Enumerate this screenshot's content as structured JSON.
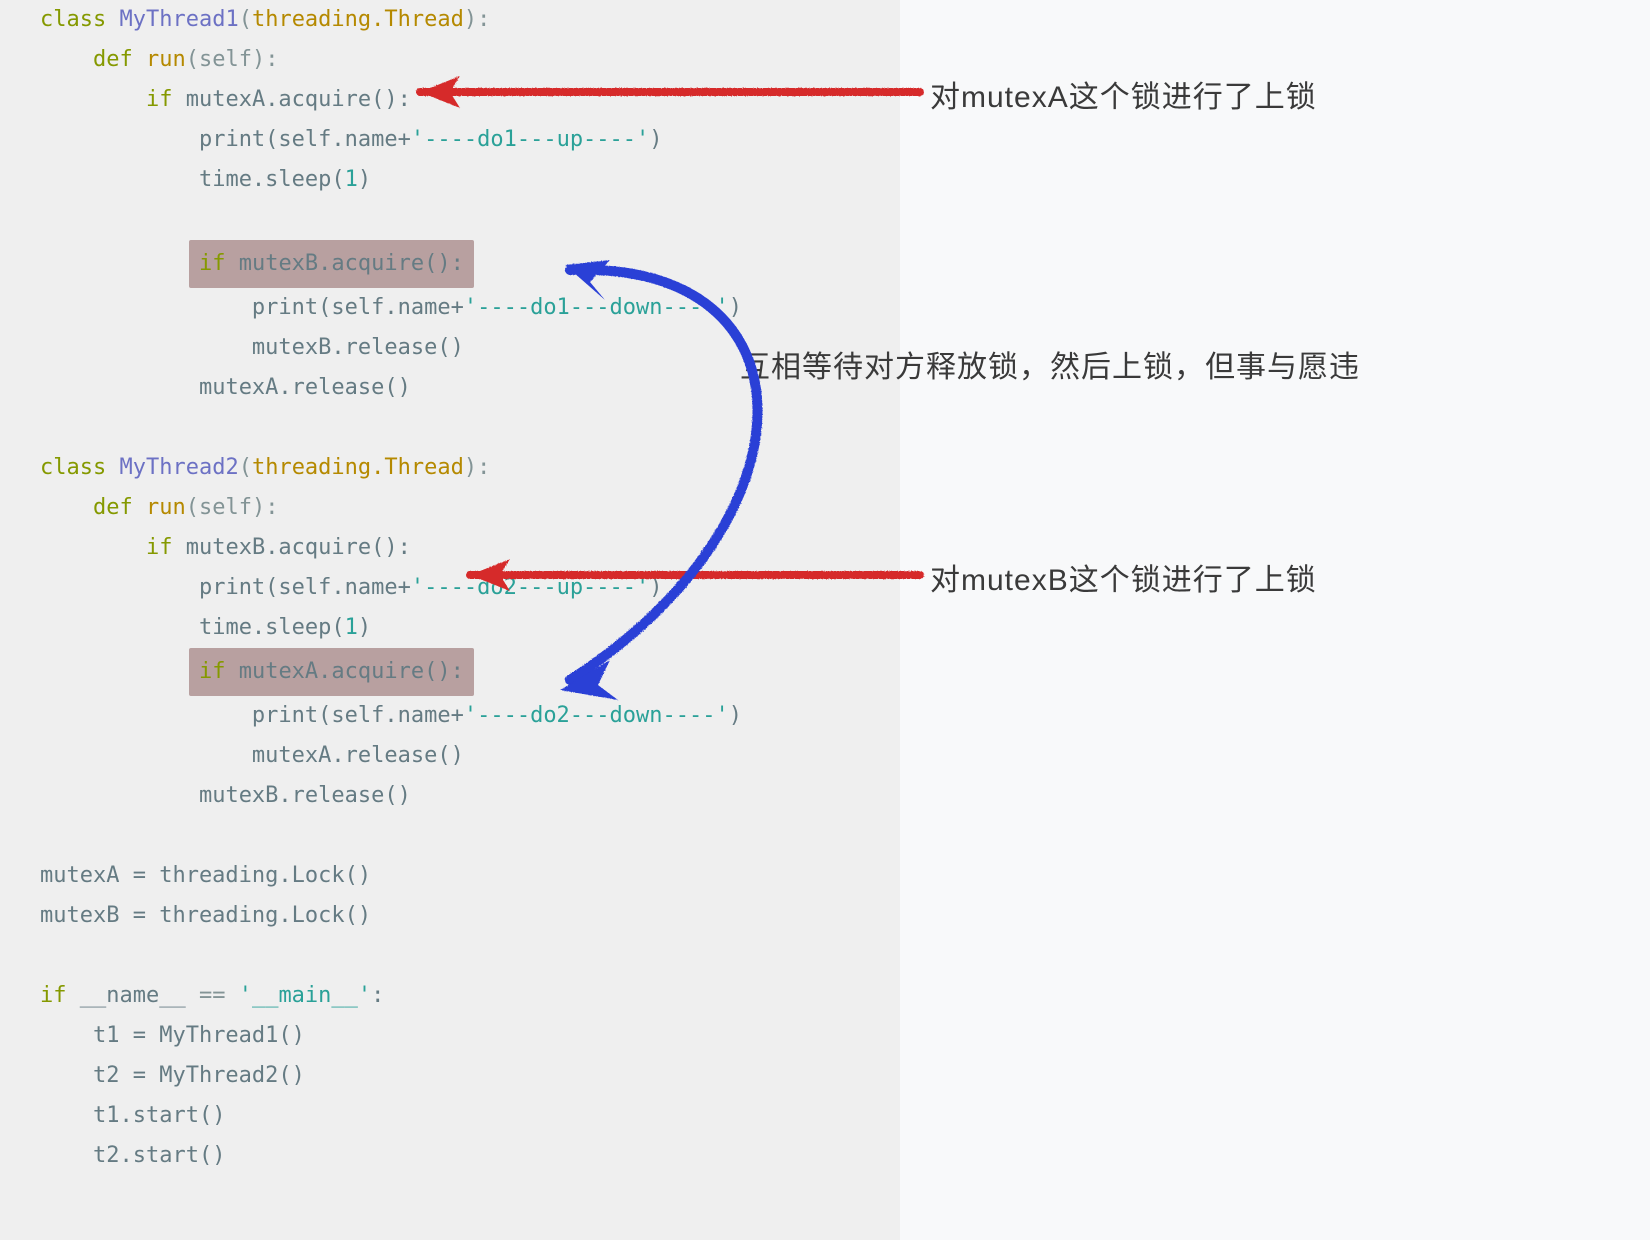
{
  "code": {
    "line1_class": "class ",
    "line1_name": "MyThread1",
    "line1_paren_open": "(",
    "line1_arg": "threading.Thread",
    "line1_paren_close": "):",
    "line2_def": "def ",
    "line2_fn": "run",
    "line2_args": "(self):",
    "line3_if": "if ",
    "line3_cond": "mutexA.acquire():",
    "line4": "print(self.name+",
    "line4_str": "'----do1---up----'",
    "line4_end": ")",
    "line5": "time.sleep(",
    "line5_num": "1",
    "line5_end": ")",
    "line7_if": "if ",
    "line7_cond": "mutexB.acquire():",
    "line8": "print(self.name+",
    "line8_str": "'----do1---down----'",
    "line8_end": ")",
    "line9": "mutexB.release()",
    "line10": "mutexA.release()",
    "line12_class": "class ",
    "line12_name": "MyThread2",
    "line12_paren_open": "(",
    "line12_arg": "threading.Thread",
    "line12_paren_close": "):",
    "line13_def": "def ",
    "line13_fn": "run",
    "line13_args": "(self):",
    "line14_if": "if ",
    "line14_cond": "mutexB.acquire():",
    "line15": "print(self.name+",
    "line15_str": "'----do2---up----'",
    "line15_end": ")",
    "line16": "time.sleep(",
    "line16_num": "1",
    "line16_end": ")",
    "line17_if": "if ",
    "line17_cond": "mutexA.acquire():",
    "line18": "print(self.name+",
    "line18_str": "'----do2---down----'",
    "line18_end": ")",
    "line19": "mutexA.release()",
    "line20": "mutexB.release()",
    "line22": "mutexA = threading.Lock()",
    "line23": "mutexB = threading.Lock()",
    "line25_if": "if ",
    "line25_name": "__name__",
    "line25_eq": " == ",
    "line25_str": "'__main__'",
    "line25_end": ":",
    "line26": "t1 = MyThread1()",
    "line27": "t2 = MyThread2()",
    "line28": "t1.start()",
    "line29": "t2.start()"
  },
  "annotations": {
    "a1": "对mutexA这个锁进行了上锁",
    "a2": "互相等待对方释放锁，然后上锁，但事与愿违",
    "a3": "对mutexB这个锁进行了上锁"
  }
}
